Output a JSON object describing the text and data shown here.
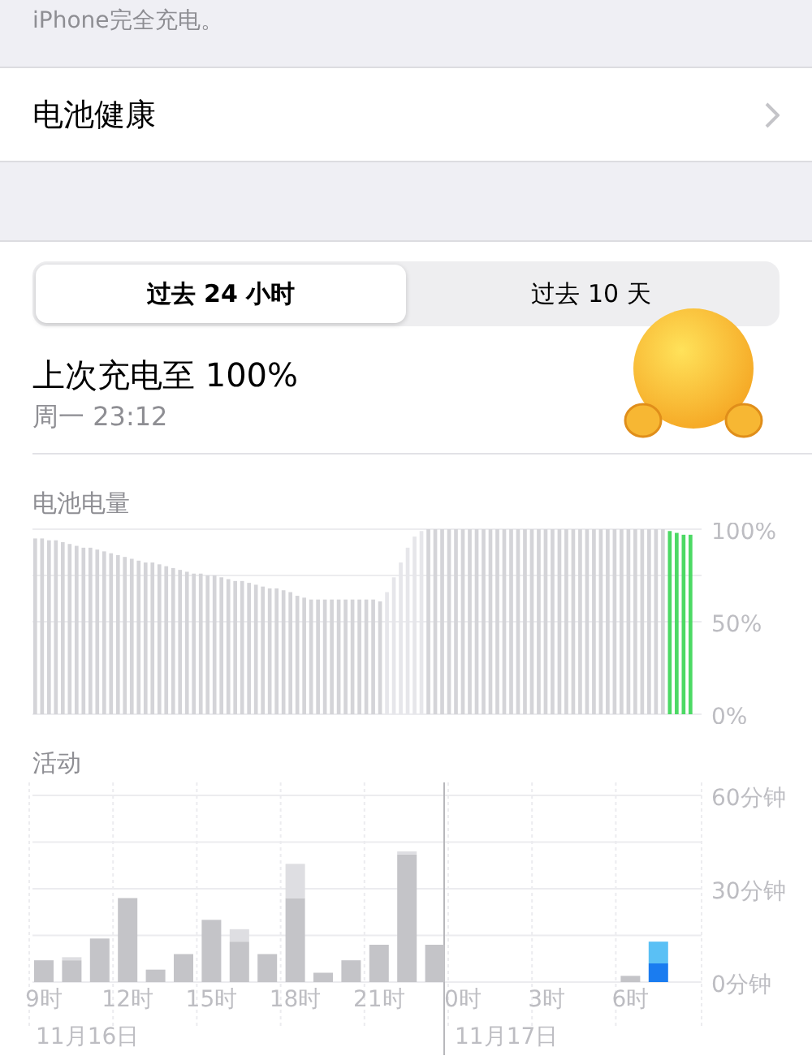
{
  "header_note": "iPhone完全充电。",
  "menu_row": {
    "label": "电池健康"
  },
  "tabs": [
    {
      "label": "过去 24 小时",
      "selected": true
    },
    {
      "label": "过去 10 天",
      "selected": false
    }
  ],
  "last_charge": {
    "title": "上次充电至 100%",
    "time": "周一 23:12"
  },
  "battery_level": {
    "title": "电池电量",
    "chart_data": {
      "type": "bar",
      "ylim": [
        0,
        100
      ],
      "yticks": [
        {
          "value": 0,
          "label": "0%"
        },
        {
          "value": 50,
          "label": "50%"
        },
        {
          "value": 100,
          "label": "100%"
        }
      ],
      "series": [
        {
          "color": "#d4d4d8",
          "values": [
            95,
            95,
            94,
            94,
            93,
            92,
            91,
            90,
            90,
            89,
            88,
            87,
            86,
            85,
            84,
            83,
            82,
            82,
            81,
            80,
            79,
            78,
            77,
            76,
            76,
            75,
            75,
            74,
            73,
            72,
            72,
            71,
            70,
            69,
            68,
            68,
            67,
            66,
            64,
            63,
            62,
            62,
            62,
            62,
            62,
            62,
            62,
            62,
            62,
            62,
            61,
            null,
            null,
            null,
            null,
            null,
            null,
            100,
            100,
            100,
            100,
            100,
            100,
            100,
            100,
            100,
            100,
            100,
            100,
            100,
            100,
            100,
            100,
            100,
            100,
            100,
            100,
            100,
            100,
            100,
            100,
            100,
            100,
            100,
            100,
            100,
            100,
            100,
            100,
            100,
            100,
            100,
            null,
            null,
            null,
            null
          ]
        },
        {
          "color": "#e6e6ea",
          "values": [
            null,
            null,
            null,
            null,
            null,
            null,
            null,
            null,
            null,
            null,
            null,
            null,
            null,
            null,
            null,
            null,
            null,
            null,
            null,
            null,
            null,
            null,
            null,
            null,
            null,
            null,
            null,
            null,
            null,
            null,
            null,
            null,
            null,
            null,
            null,
            null,
            null,
            null,
            null,
            null,
            null,
            null,
            null,
            null,
            null,
            null,
            null,
            null,
            null,
            null,
            null,
            66,
            74,
            82,
            90,
            96,
            99,
            null,
            null,
            null,
            null,
            null,
            null,
            null,
            null,
            null,
            null,
            null,
            null,
            null,
            null,
            null,
            null,
            null,
            null,
            null,
            null,
            null,
            null,
            null,
            null,
            null,
            null,
            null,
            null,
            null,
            null,
            null,
            null,
            null,
            null,
            null,
            null,
            null,
            null,
            null,
            null
          ]
        },
        {
          "color": "#4cd964",
          "values": [
            null,
            null,
            null,
            null,
            null,
            null,
            null,
            null,
            null,
            null,
            null,
            null,
            null,
            null,
            null,
            null,
            null,
            null,
            null,
            null,
            null,
            null,
            null,
            null,
            null,
            null,
            null,
            null,
            null,
            null,
            null,
            null,
            null,
            null,
            null,
            null,
            null,
            null,
            null,
            null,
            null,
            null,
            null,
            null,
            null,
            null,
            null,
            null,
            null,
            null,
            null,
            null,
            null,
            null,
            null,
            null,
            null,
            null,
            null,
            null,
            null,
            null,
            null,
            null,
            null,
            null,
            null,
            null,
            null,
            null,
            null,
            null,
            null,
            null,
            null,
            null,
            null,
            null,
            null,
            null,
            null,
            null,
            null,
            null,
            null,
            null,
            null,
            null,
            null,
            null,
            null,
            null,
            99,
            98,
            97,
            97
          ]
        }
      ]
    }
  },
  "activity": {
    "title": "活动",
    "chart_data": {
      "type": "bar",
      "stacked": true,
      "ylim": [
        0,
        60
      ],
      "grid": true,
      "categories": [
        "9时",
        null,
        null,
        "12时",
        null,
        null,
        "15时",
        null,
        null,
        "18时",
        null,
        null,
        "21时",
        null,
        null,
        "0时",
        null,
        null,
        "3时",
        null,
        null,
        "6时",
        null
      ],
      "yticks": [
        {
          "value": 0,
          "label": "0分钟"
        },
        {
          "value": 30,
          "label": "30分钟"
        },
        {
          "value": 60,
          "label": "60分钟"
        }
      ],
      "series": [
        {
          "color": "#c4c4c8",
          "values": [
            7,
            7,
            14,
            27,
            4,
            9,
            20,
            13,
            9,
            27,
            3,
            7,
            12,
            41,
            12,
            0,
            0,
            0,
            0,
            0,
            0,
            2,
            null
          ]
        },
        {
          "color": "#dedee2",
          "values": [
            null,
            1,
            null,
            null,
            null,
            null,
            null,
            4,
            null,
            11,
            null,
            null,
            null,
            1,
            null,
            null,
            null,
            null,
            null,
            null,
            null,
            null,
            null
          ]
        },
        {
          "color": "#1a7cf0",
          "values": [
            null,
            null,
            null,
            null,
            null,
            null,
            null,
            null,
            null,
            null,
            null,
            null,
            null,
            null,
            null,
            null,
            null,
            null,
            null,
            null,
            null,
            null,
            6
          ]
        },
        {
          "color": "#5ac0f5",
          "values": [
            null,
            null,
            null,
            null,
            null,
            null,
            null,
            null,
            null,
            null,
            null,
            null,
            null,
            null,
            null,
            null,
            null,
            null,
            null,
            null,
            null,
            null,
            7
          ]
        }
      ]
    },
    "date_labels": [
      "11月16日",
      "11月17日"
    ]
  }
}
